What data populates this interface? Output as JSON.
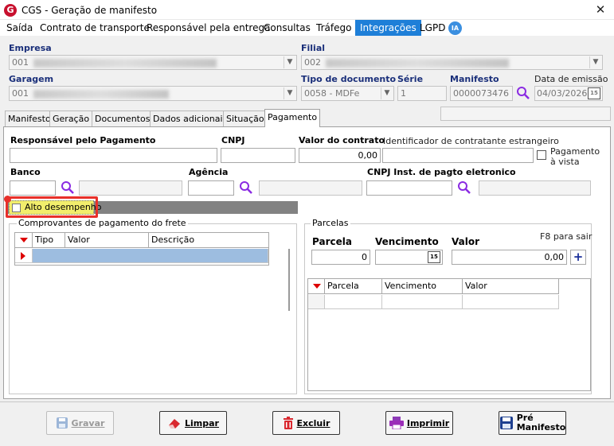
{
  "window": {
    "title": "CGS - Geração de manifesto",
    "logo_letter": "G",
    "close": "✕"
  },
  "menu": {
    "items": [
      "Saída",
      "Contrato de transporte",
      "Responsável pela entrega",
      "Consultas",
      "Tráfego",
      "Integrações",
      "LGPD"
    ],
    "active": "Integrações",
    "ia_badge": "IA"
  },
  "header": {
    "empresa_label": "Empresa",
    "empresa_value": "001",
    "filial_label": "Filial",
    "filial_value": "002",
    "garagem_label": "Garagem",
    "garagem_value": "001",
    "tipo_doc_label": "Tipo de documento",
    "tipo_doc_value": "0058 - MDFe",
    "serie_label": "Série",
    "serie_value": "1",
    "manifesto_label": "Manifesto",
    "manifesto_value": "0000073476",
    "data_emissao_label": "Data de emissão",
    "data_emissao_value": "04/03/2026",
    "calendar_icon_text": "15"
  },
  "tabs": [
    "Manifesto",
    "Geração",
    "Documentos",
    "Dados adicionais",
    "Situação",
    "Pagamento"
  ],
  "active_tab": "Pagamento",
  "pagamento": {
    "responsavel_label": "Responsável pelo Pagamento",
    "responsavel_value": "",
    "cnpj_label": "CNPJ",
    "cnpj_value": "",
    "valor_contrato_label": "Valor do contrato",
    "valor_contrato_value": "0,00",
    "id_estrangeiro_label": "Identificador de contratante estrangeiro",
    "id_estrangeiro_value": "",
    "pagamento_vista_label_1": "Pagamento",
    "pagamento_vista_label_2": "à vista",
    "banco_label": "Banco",
    "agencia_label": "Agência",
    "cnpj_inst_label": "CNPJ Inst. de pagto eletronico",
    "alto_desempenho_label": "Alto desempenho",
    "comprovantes_title": "Comprovantes de pagamento do frete",
    "comprovantes_columns": [
      "Tipo",
      "Valor",
      "Descrição"
    ],
    "parcelas_title": "Parcelas",
    "parcela_label": "Parcela",
    "parcela_value": "0",
    "vencimento_label": "Vencimento",
    "vencimento_value": " / /",
    "valor_label": "Valor",
    "valor_value": "0,00",
    "f8_hint": "F8 para sair",
    "add_symbol": "+",
    "parcelas_columns": [
      "Parcela",
      "Vencimento",
      "Valor"
    ]
  },
  "buttons": {
    "gravar": "Gravar",
    "limpar": "Limpar",
    "excluir": "Excluir",
    "imprimir": "Imprimir",
    "pre_manifesto_1": "Pré",
    "pre_manifesto_2": "Manifesto"
  },
  "colors": {
    "accent": "#1e7fd8",
    "label_blue": "#1a2f7a",
    "highlight_red": "#e8302a",
    "highlight_yellow": "#f2ee6c"
  }
}
